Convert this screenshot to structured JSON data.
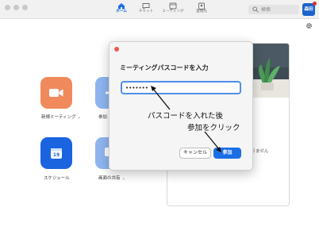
{
  "nav": {
    "tabs": [
      {
        "label": "ホーム",
        "icon": "home-icon",
        "active": true
      },
      {
        "label": "チャット",
        "icon": "chat-icon",
        "active": false
      },
      {
        "label": "ミーティング",
        "icon": "clock-icon",
        "active": false
      },
      {
        "label": "連絡先",
        "icon": "contacts-icon",
        "active": false
      }
    ],
    "search_placeholder": "検索",
    "avatar_text": "森田"
  },
  "home": {
    "tiles": [
      {
        "label": "新規ミーティング",
        "icon": "video-camera-icon",
        "color": "#f08a5d",
        "chevron": "⌄"
      },
      {
        "label": "参加",
        "icon": "plus-icon",
        "color": "#8fb5f0"
      },
      {
        "label": "スケジュール",
        "icon": "calendar-icon",
        "color": "#1a64e0",
        "day": "19"
      },
      {
        "label": "画面の共有",
        "icon": "share-screen-icon",
        "color": "#8fb5f0",
        "chevron": "⌄"
      }
    ],
    "panel_text": "ありません"
  },
  "dialog": {
    "title": "ミーティングパスコードを入力",
    "passcode_value": "•••••••",
    "cancel_label": "キャンセル",
    "join_label": "参加"
  },
  "annotation": {
    "line1": "パスコードを入れた後",
    "line2": "参加をクリック"
  },
  "colors": {
    "accent": "#1b6fe6",
    "input_border": "#4f8fe6",
    "close_red": "#ef5a50"
  }
}
